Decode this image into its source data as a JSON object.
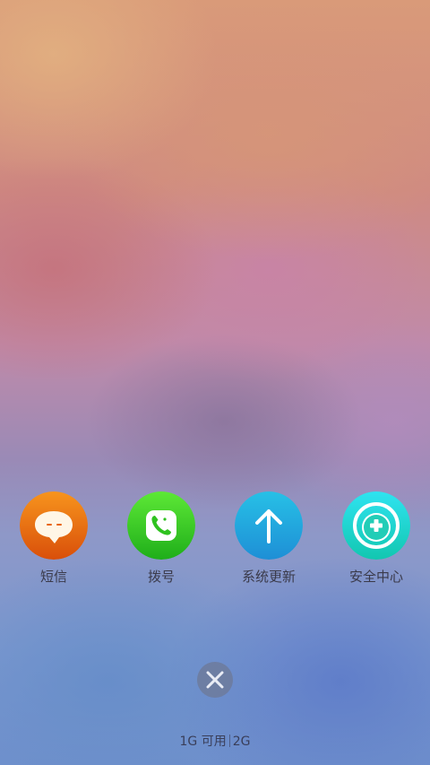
{
  "apps": [
    {
      "label": "短信",
      "icon": "message-icon",
      "color": "#e8650f"
    },
    {
      "label": "拨号",
      "icon": "phone-icon",
      "color": "#2fc21f"
    },
    {
      "label": "系统更新",
      "icon": "arrow-up-icon",
      "color": "#22a8dd"
    },
    {
      "label": "安全中心",
      "icon": "security-shield-icon",
      "color": "#1fd4c6"
    }
  ],
  "close": {
    "icon": "close-icon"
  },
  "memory": {
    "available": "1G 可用",
    "total": "2G"
  }
}
